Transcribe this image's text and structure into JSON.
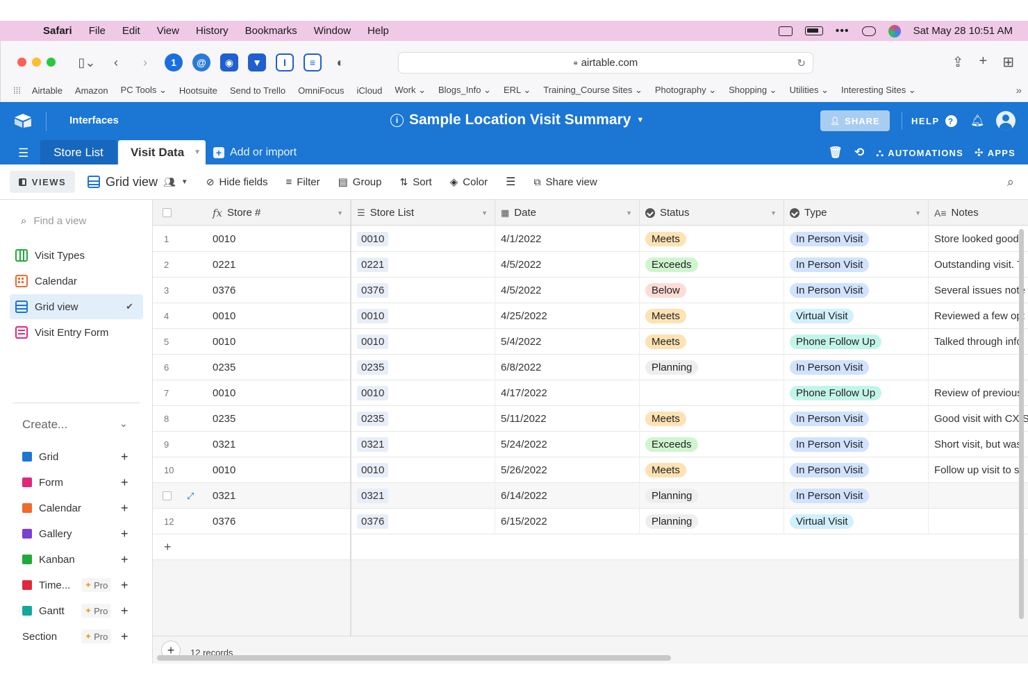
{
  "menubar": {
    "items": [
      "Safari",
      "File",
      "Edit",
      "View",
      "History",
      "Bookmarks",
      "Window",
      "Help"
    ],
    "clock": "Sat May 28  10:51 AM"
  },
  "safari": {
    "url": "airtable.com",
    "bookmarks": [
      "Airtable",
      "Amazon",
      "PC Tools ⌄",
      "Hootsuite",
      "Send to Trello",
      "OmniFocus",
      "iCloud",
      "Work ⌄",
      "Blogs_Info ⌄",
      "ERL ⌄",
      "Training_Course Sites ⌄",
      "Photography ⌄",
      "Shopping ⌄",
      "Utilities ⌄",
      "Interesting Sites ⌄"
    ]
  },
  "header": {
    "interfaces": "Interfaces",
    "base_title": "Sample Location Visit Summary",
    "share": "SHARE",
    "help": "HELP",
    "automations": "AUTOMATIONS",
    "apps": "APPS",
    "colors": {
      "brand": "#1b76d4"
    }
  },
  "tabs": {
    "store_list": "Store List",
    "visit_data": "Visit Data",
    "add_import": "Add or import"
  },
  "viewbar": {
    "views": "VIEWS",
    "view_name": "Grid view",
    "hide_fields": "Hide fields",
    "filter": "Filter",
    "group": "Group",
    "sort": "Sort",
    "color": "Color",
    "share_view": "Share view"
  },
  "sidebar": {
    "find_placeholder": "Find a view",
    "views": [
      {
        "label": "Visit Types",
        "icon": "kanban-icon",
        "color": "#20a93a"
      },
      {
        "label": "Calendar",
        "icon": "calendar-icon",
        "color": "#f06a2e"
      },
      {
        "label": "Grid view",
        "icon": "grid-icon",
        "color": "#1b76d4"
      },
      {
        "label": "Visit Entry Form",
        "icon": "form-icon",
        "color": "#e0287a"
      }
    ],
    "create_label": "Create...",
    "create": [
      {
        "label": "Grid",
        "color": "#1b76d4",
        "pro": false
      },
      {
        "label": "Form",
        "color": "#e0287a",
        "pro": false
      },
      {
        "label": "Calendar",
        "color": "#f06a2e",
        "pro": false
      },
      {
        "label": "Gallery",
        "color": "#7b3fd4",
        "pro": false
      },
      {
        "label": "Kanban",
        "color": "#20a93a",
        "pro": false
      },
      {
        "label": "Time...",
        "color": "#e0283a",
        "pro": true
      },
      {
        "label": "Gantt",
        "color": "#12a89a",
        "pro": true
      },
      {
        "label": "Section",
        "color": "",
        "pro": true
      }
    ],
    "pro_label": "Pro"
  },
  "grid": {
    "columns": {
      "store_num": "Store #",
      "store_list": "Store List",
      "date": "Date",
      "status": "Status",
      "type": "Type",
      "notes": "Notes"
    },
    "status_colors": {
      "Meets": "#fde2b3",
      "Exceeds": "#cff5cf",
      "Below": "#fcdcd4",
      "Planning": "#eeeeee"
    },
    "type_colors": {
      "In Person Visit": "#d1e2ff",
      "Virtual Visit": "#d0f0fd",
      "Phone Follow Up": "#c2f5e9"
    },
    "rows": [
      {
        "n": "1",
        "store": "0010",
        "link": "0010",
        "date": "4/1/2022",
        "status": "Meets",
        "type": "In Person Visit",
        "notes": "Store looked good."
      },
      {
        "n": "2",
        "store": "0221",
        "link": "0221",
        "date": "4/5/2022",
        "status": "Exceeds",
        "type": "In Person Visit",
        "notes": "Outstanding visit. T"
      },
      {
        "n": "3",
        "store": "0376",
        "link": "0376",
        "date": "4/5/2022",
        "status": "Below",
        "type": "In Person Visit",
        "notes": "Several issues note"
      },
      {
        "n": "4",
        "store": "0010",
        "link": "0010",
        "date": "4/25/2022",
        "status": "Meets",
        "type": "Virtual Visit",
        "notes": "Reviewed a few op:"
      },
      {
        "n": "5",
        "store": "0010",
        "link": "0010",
        "date": "5/4/2022",
        "status": "Meets",
        "type": "Phone Follow Up",
        "notes": "Talked through info"
      },
      {
        "n": "6",
        "store": "0235",
        "link": "0235",
        "date": "6/8/2022",
        "status": "Planning",
        "type": "In Person Visit",
        "notes": ""
      },
      {
        "n": "7",
        "store": "0010",
        "link": "0010",
        "date": "4/17/2022",
        "status": "",
        "type": "Phone Follow Up",
        "notes": "Review of previous"
      },
      {
        "n": "8",
        "store": "0235",
        "link": "0235",
        "date": "5/11/2022",
        "status": "Meets",
        "type": "In Person Visit",
        "notes": "Good visit with CX S"
      },
      {
        "n": "9",
        "store": "0321",
        "link": "0321",
        "date": "5/24/2022",
        "status": "Exceeds",
        "type": "In Person Visit",
        "notes": "Short visit, but was"
      },
      {
        "n": "10",
        "store": "0010",
        "link": "0010",
        "date": "5/26/2022",
        "status": "Meets",
        "type": "In Person Visit",
        "notes": "Follow up visit to st"
      },
      {
        "n": "",
        "store": "0321",
        "link": "0321",
        "date": "6/14/2022",
        "status": "Planning",
        "type": "In Person Visit",
        "notes": ""
      },
      {
        "n": "12",
        "store": "0376",
        "link": "0376",
        "date": "6/15/2022",
        "status": "Planning",
        "type": "Virtual Visit",
        "notes": ""
      }
    ],
    "record_count": "12 records"
  }
}
